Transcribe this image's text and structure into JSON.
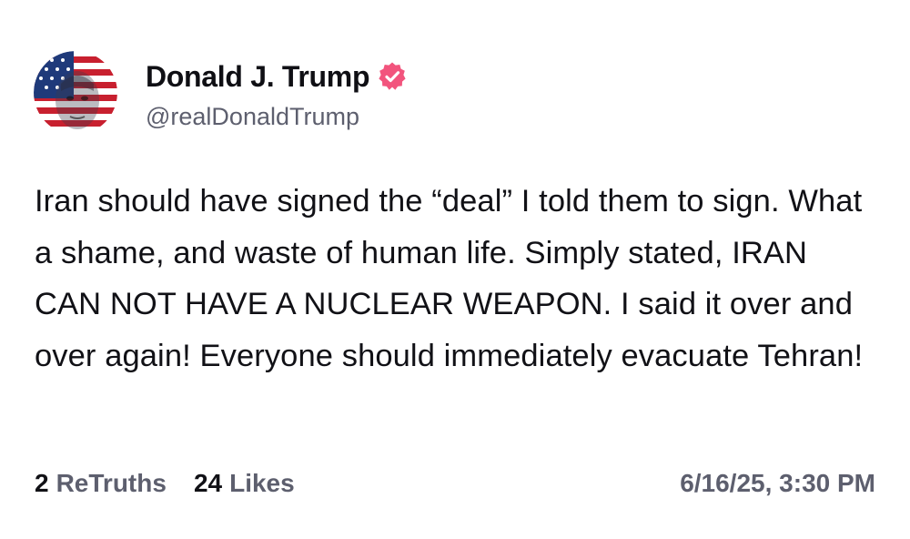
{
  "author": {
    "display_name": "Donald J. Trump",
    "handle": "@realDonaldTrump",
    "verified_icon": "verified-badge-icon",
    "verified_color": "#f2547d"
  },
  "post": {
    "text": "Iran should have signed the “deal” I told them to sign. What a shame, and waste of human life. Simply stated, IRAN CAN NOT HAVE A NUCLEAR WEAPON. I said it over and over again! Everyone should immediately evacuate Tehran!"
  },
  "stats": {
    "retruths_count": "2",
    "retruths_label": "ReTruths",
    "likes_count": "24",
    "likes_label": "Likes"
  },
  "timestamp": "6/16/25, 3:30 PM",
  "colors": {
    "text_primary": "#111116",
    "text_secondary": "#5d5f6e",
    "background": "#ffffff"
  }
}
